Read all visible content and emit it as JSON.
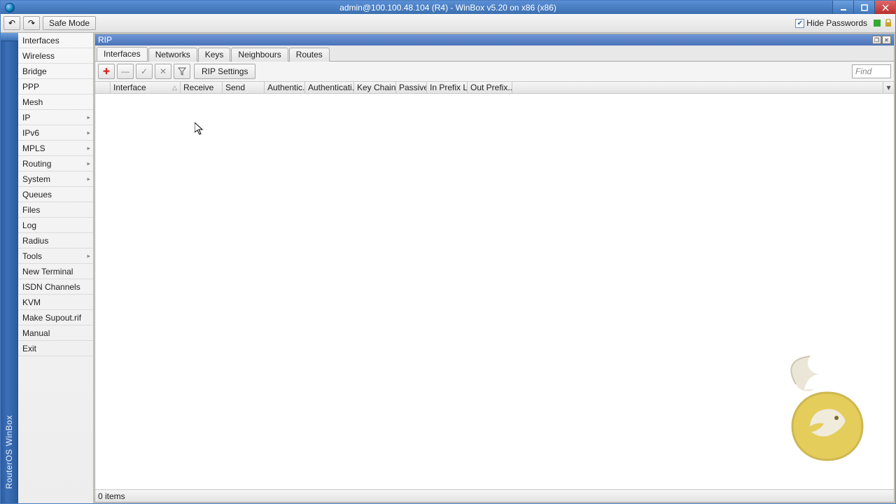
{
  "window": {
    "title": "admin@100.100.48.104 (R4) - WinBox v5.20 on x86 (x86)"
  },
  "toolbar": {
    "safe_mode": "Safe Mode",
    "hide_passwords": "Hide Passwords"
  },
  "sidebar_rail": {
    "text": "RouterOS WinBox"
  },
  "menu": {
    "items": [
      {
        "label": "Interfaces",
        "submenu": false
      },
      {
        "label": "Wireless",
        "submenu": false
      },
      {
        "label": "Bridge",
        "submenu": false
      },
      {
        "label": "PPP",
        "submenu": false
      },
      {
        "label": "Mesh",
        "submenu": false
      },
      {
        "label": "IP",
        "submenu": true
      },
      {
        "label": "IPv6",
        "submenu": true
      },
      {
        "label": "MPLS",
        "submenu": true
      },
      {
        "label": "Routing",
        "submenu": true
      },
      {
        "label": "System",
        "submenu": true
      },
      {
        "label": "Queues",
        "submenu": false
      },
      {
        "label": "Files",
        "submenu": false
      },
      {
        "label": "Log",
        "submenu": false
      },
      {
        "label": "Radius",
        "submenu": false
      },
      {
        "label": "Tools",
        "submenu": true
      },
      {
        "label": "New Terminal",
        "submenu": false
      },
      {
        "label": "ISDN Channels",
        "submenu": false
      },
      {
        "label": "KVM",
        "submenu": false
      },
      {
        "label": "Make Supout.rif",
        "submenu": false
      },
      {
        "label": "Manual",
        "submenu": false
      },
      {
        "label": "Exit",
        "submenu": false
      }
    ]
  },
  "inner": {
    "title": "RIP",
    "tabs": [
      {
        "label": "Interfaces",
        "active": true
      },
      {
        "label": "Networks",
        "active": false
      },
      {
        "label": "Keys",
        "active": false
      },
      {
        "label": "Neighbours",
        "active": false
      },
      {
        "label": "Routes",
        "active": false
      }
    ],
    "toolbar": {
      "rip_settings": "RIP Settings",
      "find_placeholder": "Find"
    },
    "columns": [
      "Interface",
      "Receive",
      "Send",
      "Authentic...",
      "Authenticati...",
      "Key Chain",
      "Passive",
      "In Prefix L...",
      "Out Prefix..."
    ],
    "status": "0 items"
  },
  "icons": {
    "undo": "↶",
    "redo": "↷",
    "add": "✚",
    "remove": "—",
    "enable": "✓",
    "disable": "✕",
    "filter": "▼",
    "sort": "△",
    "chevron": "▸",
    "drop": "▾"
  }
}
